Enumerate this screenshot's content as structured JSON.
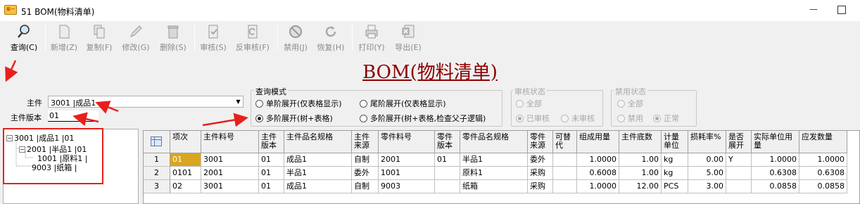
{
  "window": {
    "title": "51 BOM(物料清单)",
    "app_icon_text": "易一通",
    "minimize": "—"
  },
  "toolbar": {
    "query": "查询(C)",
    "add": "新增(Z)",
    "copy": "复制(F)",
    "edit": "修改(G)",
    "delete": "删除(S)",
    "audit": "审核(S)",
    "unaudit": "反审核(F)",
    "disable": "禁用(J)",
    "restore": "恢复(H)",
    "print": "打印(Y)",
    "export": "导出(E)"
  },
  "page_title": "BOM(物料清单)",
  "form": {
    "main_part_label": "主件",
    "main_part_value": "3001 |成品1",
    "version_label": "主件版本",
    "version_value": "01",
    "dropdown_arrow": "▼"
  },
  "query_mode": {
    "legend": "查询模式",
    "options": [
      "单阶展开(仅表格显示)",
      "尾阶展开(仅表格显示)",
      "多阶展开(树+表格)",
      "多阶展开(树+表格,检查父子逻辑)"
    ],
    "selected": 2
  },
  "audit_status": {
    "legend": "审核状态",
    "all": "全部",
    "audited": "已审核",
    "unaudited": "未审核"
  },
  "disable_status": {
    "legend": "禁用状态",
    "all": "全部",
    "disabled": "禁用",
    "normal": "正常"
  },
  "tree": {
    "root": "3001 |成品1 |01",
    "child": "2001 |半品1 |01",
    "grandchild": "1001 |原料1 |",
    "leaf": "9003 |纸箱 |",
    "toggle_expanded": "−"
  },
  "grid": {
    "headers": [
      "项次",
      "主件料号",
      "主件版本",
      "主件品名规格",
      "主件来源",
      "零件料号",
      "零件版本",
      "零件品名规格",
      "零件来源",
      "可替代",
      "组成用量",
      "主件底数",
      "计量单位",
      "损耗率%",
      "是否展开",
      "实际单位用量",
      "应发数量"
    ],
    "rows": [
      [
        "1",
        "01",
        "3001",
        "01",
        "成品1",
        "自制",
        "2001",
        "01",
        "半品1",
        "委外",
        "",
        "1.0000",
        "1.00",
        "kg",
        "0.00",
        "Y",
        "1.0000",
        "1.0000"
      ],
      [
        "2",
        "0101",
        "2001",
        "01",
        "半品1",
        "委外",
        "1001",
        "",
        "原料1",
        "采购",
        "",
        "0.6008",
        "1.00",
        "kg",
        "5.00",
        "",
        "0.6308",
        "0.6308"
      ],
      [
        "3",
        "02",
        "3001",
        "01",
        "成品1",
        "自制",
        "9003",
        "",
        "纸箱",
        "采购",
        "",
        "1.0000",
        "12.00",
        "PCS",
        "3.00",
        "",
        "0.0858",
        "0.0858"
      ]
    ]
  },
  "colors": {
    "title": "#8b0000",
    "annotation": "#e8201c",
    "selected_cell": "#daa520"
  }
}
